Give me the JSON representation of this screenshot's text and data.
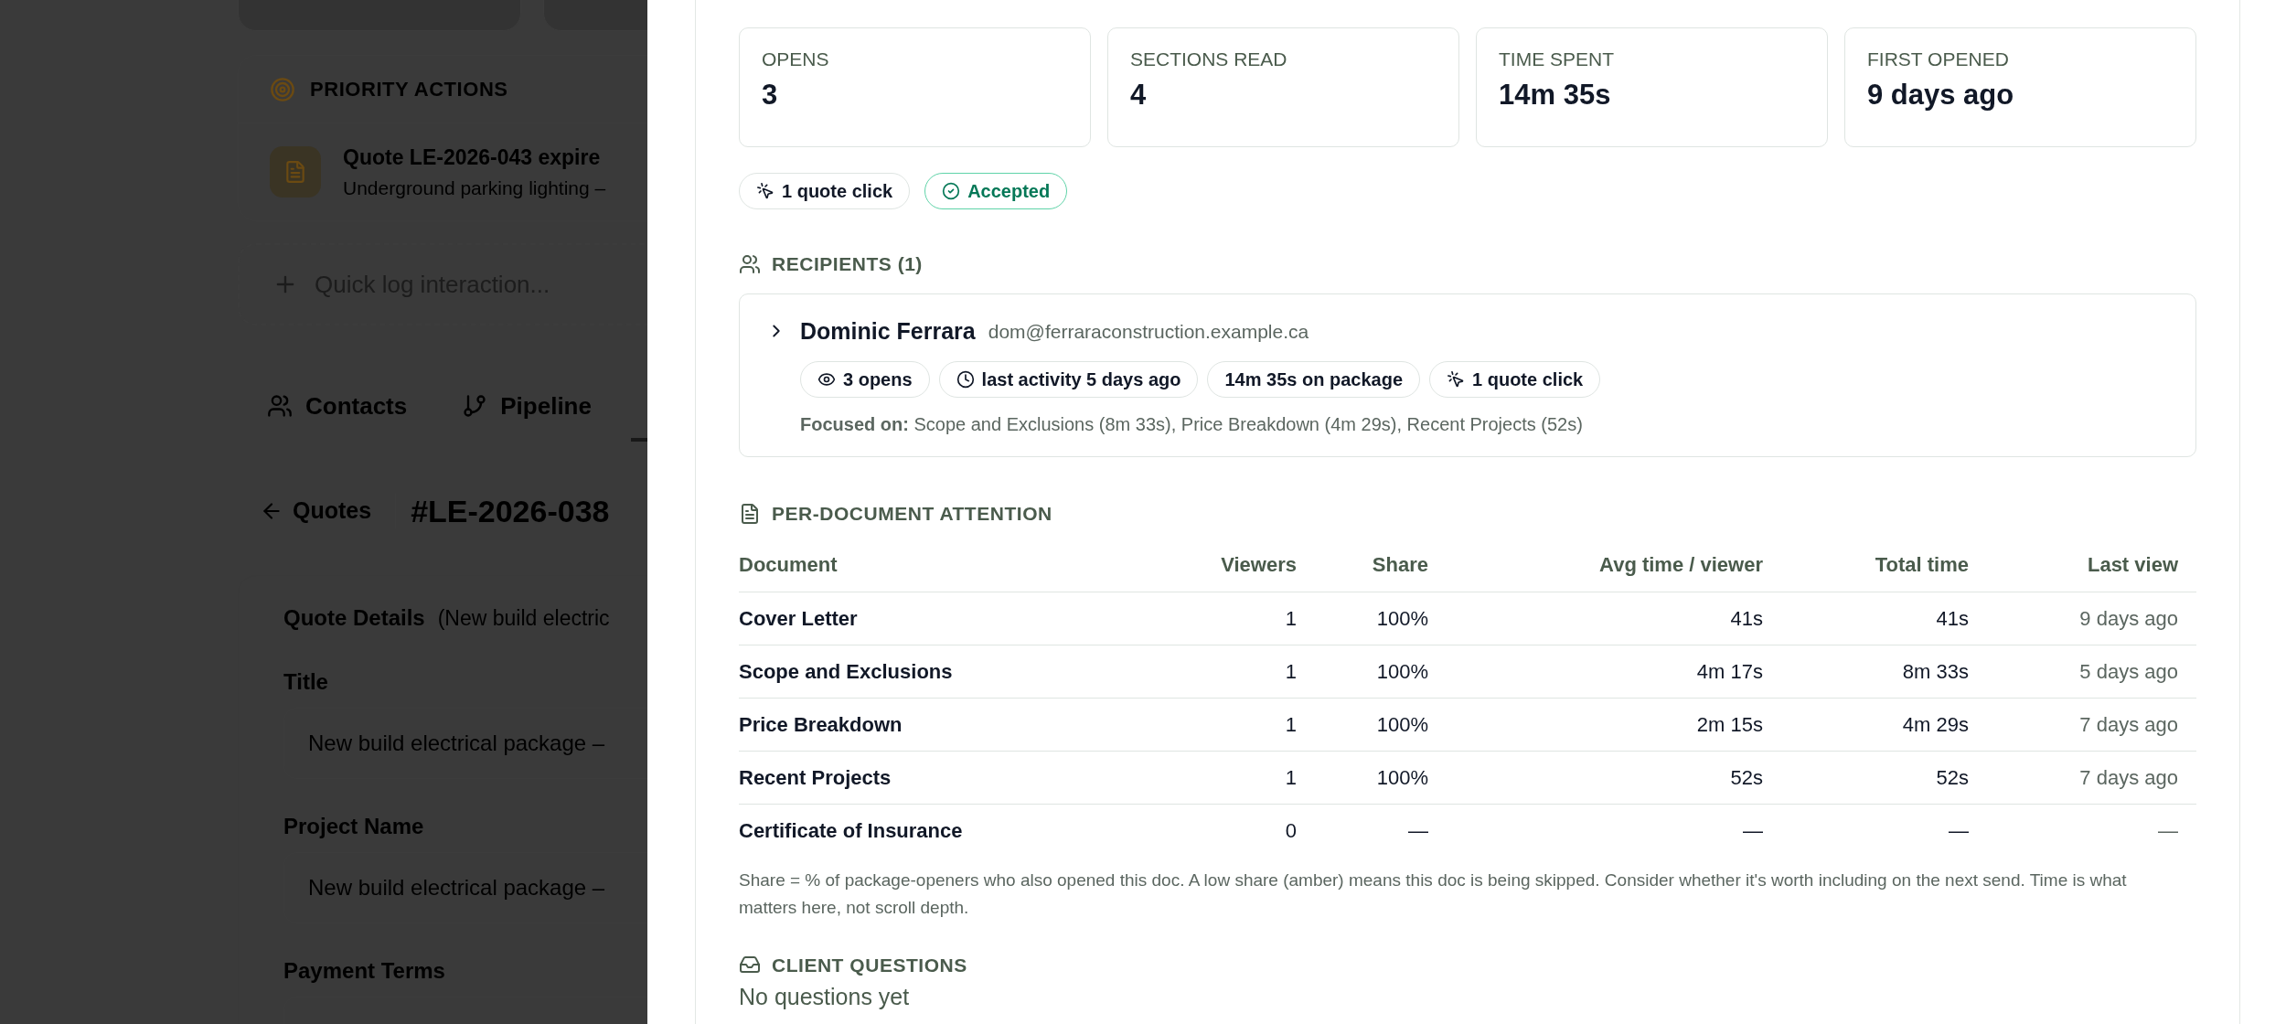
{
  "background": {
    "priority_actions": {
      "title": "PRIORITY ACTIONS",
      "items": [
        {
          "title": "Quote LE-2026-043 expire",
          "subtitle": "Underground parking lighting –"
        }
      ]
    },
    "quick_log": {
      "placeholder": "Quick log interaction..."
    },
    "tabs": [
      {
        "label": "Contacts",
        "kind": "contacts",
        "selected": false
      },
      {
        "label": "Pipeline",
        "kind": "pipeline",
        "selected": false
      }
    ],
    "breadcrumb": {
      "back": "Quotes",
      "quote_number": "#LE-2026-038"
    },
    "quote_details": {
      "title": "Quote Details",
      "subtitle": "(New build electric",
      "fields": [
        {
          "label": "Title",
          "value": "New build electrical package –"
        },
        {
          "label": "Project Name",
          "value": "New build electrical package –"
        },
        {
          "label": "Payment Terms"
        }
      ]
    }
  },
  "drawer": {
    "stats": [
      {
        "label": "OPENS",
        "value": "3"
      },
      {
        "label": "SECTIONS READ",
        "value": "4"
      },
      {
        "label": "TIME SPENT",
        "value": "14m 35s"
      },
      {
        "label": "FIRST OPENED",
        "value": "9 days ago"
      }
    ],
    "badges": [
      {
        "kind": "click",
        "label": "1 quote click"
      },
      {
        "kind": "accepted",
        "label": "Accepted"
      }
    ],
    "recipients": {
      "title": "RECIPIENTS (1)",
      "items": [
        {
          "name": "Dominic Ferrara",
          "email": "dom@ferraraconstruction.example.ca",
          "expanded": false,
          "chips": [
            {
              "kind": "eye",
              "label": "3 opens"
            },
            {
              "kind": "clock",
              "label": "last activity 5 days ago"
            },
            {
              "kind": "plain",
              "label": "14m 35s on package"
            },
            {
              "kind": "click",
              "label": "1 quote click"
            }
          ],
          "focused": "**Focused on:** Scope and Exclusions (8m 33s), Price Breakdown (4m 29s), Recent Projects (52s)"
        }
      ]
    },
    "attention": {
      "title": "PER-DOCUMENT ATTENTION",
      "columns": [
        "Document",
        "Viewers",
        "Share",
        "Avg time / viewer",
        "Total time",
        "Last view"
      ],
      "rows": [
        [
          "Cover Letter",
          "1",
          "100%",
          "41s",
          "41s",
          "9 days ago"
        ],
        [
          "Scope and Exclusions",
          "1",
          "100%",
          "4m 17s",
          "8m 33s",
          "5 days ago"
        ],
        [
          "Price Breakdown",
          "1",
          "100%",
          "2m 15s",
          "4m 29s",
          "7 days ago"
        ],
        [
          "Recent Projects",
          "1",
          "100%",
          "52s",
          "52s",
          "7 days ago"
        ],
        [
          "Certificate of Insurance",
          "0",
          "—",
          "—",
          "—",
          "—"
        ]
      ],
      "note": "Share = % of package-openers who also opened this doc. A low share (amber) means this doc is being skipped. Consider whether it's worth including on the next send. Time is what matters here, not scroll depth."
    },
    "client_questions": {
      "title": "CLIENT QUESTIONS",
      "empty": "No questions yet"
    }
  }
}
